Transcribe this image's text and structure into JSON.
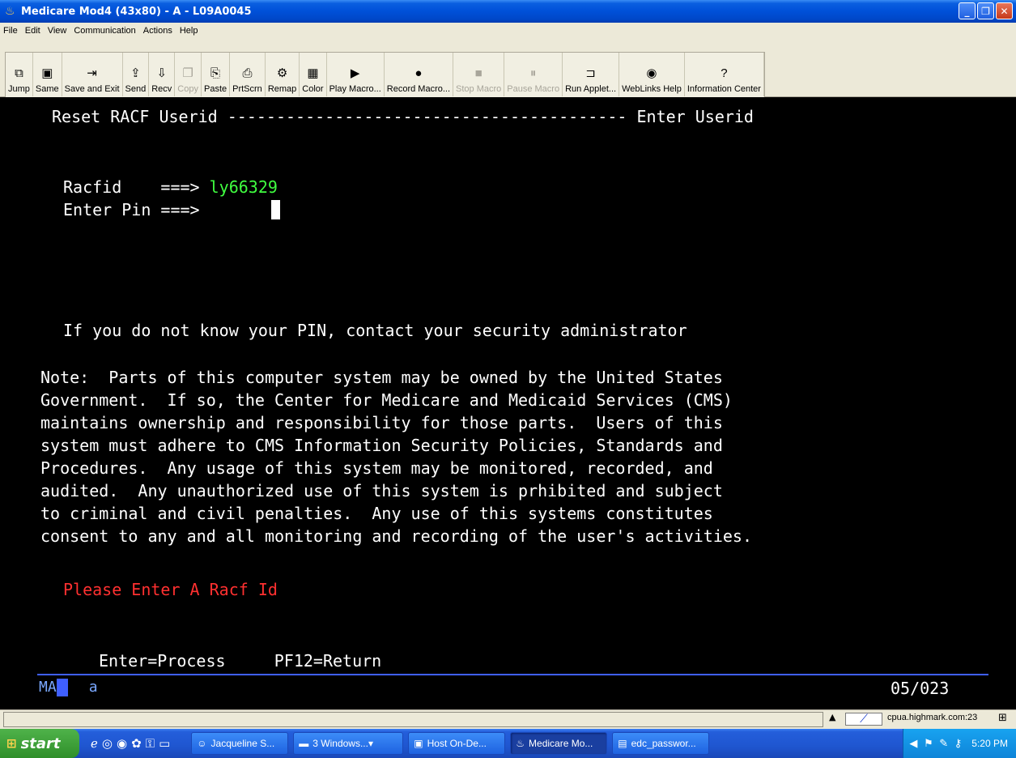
{
  "window": {
    "title": "Medicare Mod4 (43x80) - A - L09A0045",
    "minimize": "_",
    "maximize": "❐",
    "close": "✕"
  },
  "menu": [
    "File",
    "Edit",
    "View",
    "Communication",
    "Actions",
    "Help"
  ],
  "toolbar": {
    "buttons": [
      {
        "label": "Jump",
        "icon": "jump-icon",
        "glyph": "⧉",
        "enabled": true
      },
      {
        "label": "Same",
        "icon": "same-icon",
        "glyph": "▣",
        "enabled": true
      },
      {
        "label": "Save and Exit",
        "icon": "save-exit-icon",
        "glyph": "⇥",
        "enabled": true
      },
      {
        "label": "Send",
        "icon": "send-icon",
        "glyph": "⇪",
        "enabled": true
      },
      {
        "label": "Recv",
        "icon": "recv-icon",
        "glyph": "⇩",
        "enabled": true
      },
      {
        "label": "Copy",
        "icon": "copy-icon",
        "glyph": "❐",
        "enabled": false
      },
      {
        "label": "Paste",
        "icon": "paste-icon",
        "glyph": "⎘",
        "enabled": true
      },
      {
        "label": "PrtScrn",
        "icon": "print-screen-icon",
        "glyph": "⎙",
        "enabled": true
      },
      {
        "label": "Remap",
        "icon": "remap-icon",
        "glyph": "⚙",
        "enabled": true
      },
      {
        "label": "Color",
        "icon": "color-icon",
        "glyph": "▦",
        "enabled": true
      },
      {
        "label": "Play Macro...",
        "icon": "play-macro-icon",
        "glyph": "▶",
        "enabled": true
      },
      {
        "label": "Record Macro...",
        "icon": "record-macro-icon",
        "glyph": "●",
        "enabled": true
      },
      {
        "label": "Stop Macro",
        "icon": "stop-macro-icon",
        "glyph": "■",
        "enabled": false
      },
      {
        "label": "Pause Macro",
        "icon": "pause-macro-icon",
        "glyph": "⏸",
        "enabled": false
      },
      {
        "label": "Run Applet...",
        "icon": "run-applet-icon",
        "glyph": "⊐",
        "enabled": true
      },
      {
        "label": "WebLinks Help",
        "icon": "weblinks-help-icon",
        "glyph": "◉",
        "enabled": true
      },
      {
        "label": "Information Center",
        "icon": "information-center-icon",
        "glyph": "?",
        "enabled": true
      }
    ]
  },
  "terminal": {
    "header_left": "Reset RACF Userid",
    "header_dashes": "-----------------------------------------",
    "header_right": "Enter Userid",
    "racfid_label": "Racfid    ===>",
    "racfid_value": "ly66329",
    "pin_label": "Enter Pin ===>",
    "pin_hint": "If you do not know your PIN, contact your security administrator",
    "note_lines": [
      "Note:  Parts of this computer system may be owned by the United States",
      "Government.  If so, the Center for Medicare and Medicaid Services (CMS)",
      "maintains ownership and responsibility for those parts.  Users of this",
      "system must adhere to CMS Information Security Policies, Standards and",
      "Procedures.  Any usage of this system may be monitored, recorded, and",
      "audited.  Any unauthorized use of this system is prhibited and subject",
      "to criminal and civil penalties.  Any use of this systems constitutes",
      "consent to any and all monitoring and recording of the user's activities."
    ],
    "error_message": "Please Enter A Racf Id",
    "pf_keys": "Enter=Process     PF12=Return",
    "status_ma": "MA",
    "status_a": "a",
    "cursor_position": "05/023"
  },
  "oia": {
    "host": "cpua.highmark.com:23"
  },
  "taskbar": {
    "start": "start",
    "tasks": [
      {
        "label": "Jacqueline S...",
        "icon": "chat-icon",
        "active": false
      },
      {
        "label": "3 Windows...",
        "icon": "folder-icon",
        "active": false
      },
      {
        "label": "Host On-De...",
        "icon": "host-icon",
        "active": false
      },
      {
        "label": "Medicare Mo...",
        "icon": "java-icon",
        "active": true
      },
      {
        "label": "edc_passwor...",
        "icon": "document-icon",
        "active": false
      }
    ],
    "clock": "5:20 PM"
  }
}
